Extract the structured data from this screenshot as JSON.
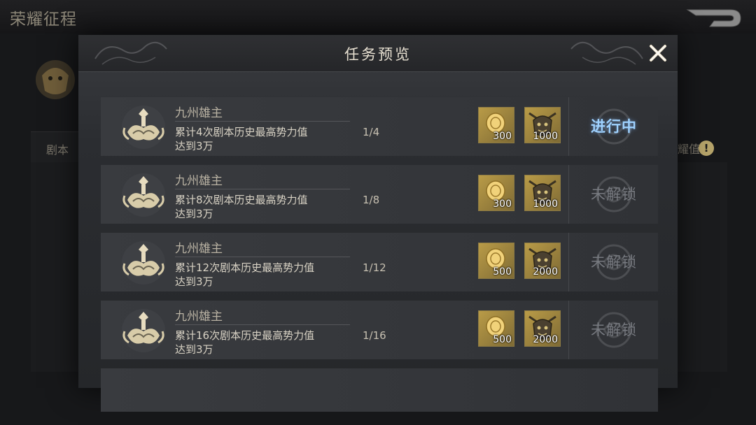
{
  "page": {
    "title": "荣耀征程",
    "bg_tab_label": "剧本",
    "bg_right_label": "耀值",
    "info_glyph": "!"
  },
  "modal": {
    "title": "任务预览"
  },
  "tasks": [
    {
      "name": "九州雄主",
      "desc": "累计4次剧本历史最高势力值\n达到3万",
      "progress": "1/4",
      "rewards": [
        "300",
        "1000"
      ],
      "status": "进行中",
      "state": "active"
    },
    {
      "name": "九州雄主",
      "desc": "累计8次剧本历史最高势力值\n达到3万",
      "progress": "1/8",
      "rewards": [
        "300",
        "1000"
      ],
      "status": "未解锁",
      "state": "locked"
    },
    {
      "name": "九州雄主",
      "desc": "累计12次剧本历史最高势力值\n达到3万",
      "progress": "1/12",
      "rewards": [
        "500",
        "2000"
      ],
      "status": "未解锁",
      "state": "locked"
    },
    {
      "name": "九州雄主",
      "desc": "累计16次剧本历史最高势力值\n达到3万",
      "progress": "1/16",
      "rewards": [
        "500",
        "2000"
      ],
      "status": "未解锁",
      "state": "locked"
    }
  ],
  "colors": {
    "accent_active": "#9fd2ff",
    "gold": "#b99b47",
    "locked": "#777a80"
  },
  "icons": {
    "close": "close-icon",
    "back": "back-arrow-icon",
    "task_emblem": "lotus-crest-icon",
    "reward_coin": "gold-coin-icon",
    "reward_mask": "bronze-mask-icon"
  }
}
